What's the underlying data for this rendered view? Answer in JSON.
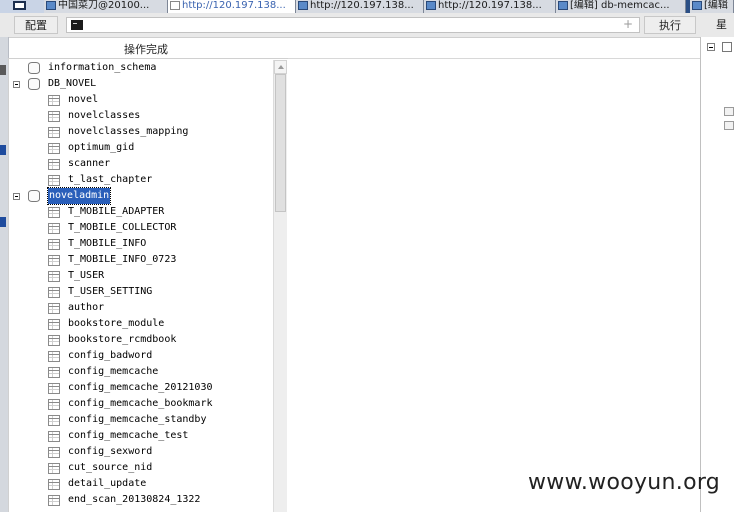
{
  "taskbar": {
    "items": [
      {
        "label": "中国菜刀@20100...",
        "icon": "window-icon",
        "active": false
      },
      {
        "label": "http://120.197.138...",
        "icon": "document-icon",
        "active": true
      },
      {
        "label": "http://120.197.138...",
        "icon": "browser-icon",
        "active": false
      },
      {
        "label": "http://120.197.138...",
        "icon": "browser-icon",
        "active": false
      },
      {
        "label": "[编辑] db-memcac...",
        "icon": "editor-icon",
        "active": false
      },
      {
        "label": "[编辑",
        "icon": "editor-icon",
        "active": false
      }
    ]
  },
  "toolbar": {
    "config_label": "配置",
    "command_value": "",
    "execute_label": "执行",
    "star_label": "星"
  },
  "status": {
    "text": "操作完成"
  },
  "tree": {
    "databases": [
      {
        "name": "information_schema",
        "expanded": false,
        "selected": false,
        "tables": []
      },
      {
        "name": "DB_NOVEL",
        "expanded": true,
        "selected": false,
        "tables": [
          "novel",
          "novelclasses",
          "novelclasses_mapping",
          "optimum_gid",
          "scanner",
          "t_last_chapter"
        ]
      },
      {
        "name": "noveladmin",
        "expanded": true,
        "selected": true,
        "tables": [
          "T_MOBILE_ADAPTER",
          "T_MOBILE_COLLECTOR",
          "T_MOBILE_INFO",
          "T_MOBILE_INFO_0723",
          "T_USER",
          "T_USER_SETTING",
          "author",
          "bookstore_module",
          "bookstore_rcmdbook",
          "config_badword",
          "config_memcache",
          "config_memcache_20121030",
          "config_memcache_bookmark",
          "config_memcache_standby",
          "config_memcache_test",
          "config_sexword",
          "cut_source_nid",
          "detail_update",
          "end_scan_20130824_1322"
        ]
      }
    ]
  },
  "watermark": "www.wooyun.org",
  "colors": {
    "selection": "#2a5fba",
    "taskbar": "#2b4f86",
    "toolbar": "#e9e9e9"
  }
}
